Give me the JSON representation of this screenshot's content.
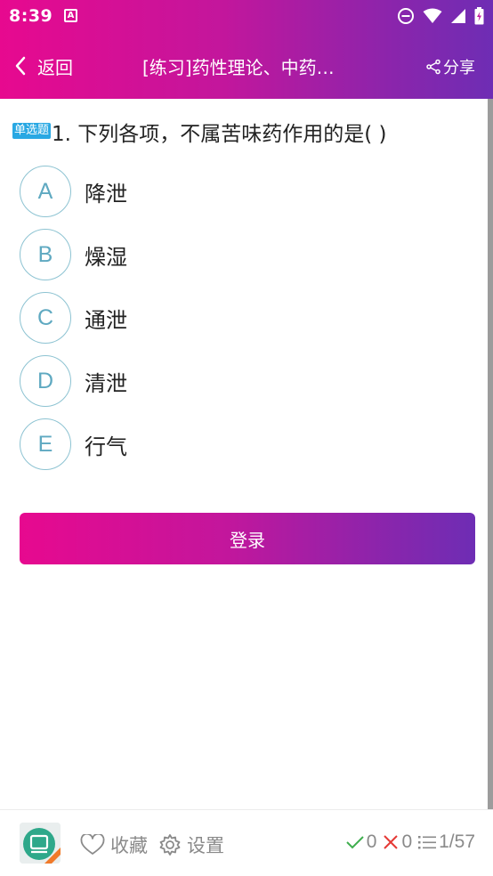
{
  "status": {
    "time": "8:39",
    "notif_icon": "A"
  },
  "nav": {
    "back_label": "返回",
    "title": "[练习]药性理论、中药的作用",
    "share_label": "分享"
  },
  "question": {
    "type_label": "单选题",
    "text": "1. 下列各项，不属苦味药作用的是( )",
    "options": [
      {
        "letter": "A",
        "text": "降泄"
      },
      {
        "letter": "B",
        "text": "燥湿"
      },
      {
        "letter": "C",
        "text": "通泄"
      },
      {
        "letter": "D",
        "text": "清泄"
      },
      {
        "letter": "E",
        "text": "行气"
      }
    ]
  },
  "login_label": "登录",
  "bottom": {
    "favorite_label": "收藏",
    "settings_label": "设置",
    "correct_count": "0",
    "wrong_count": "0",
    "progress": "1/57"
  },
  "colors": {
    "gradient_start": "#e7098f",
    "gradient_end": "#6e2db4",
    "option_border": "#8dc3d2",
    "type_badge": "#29a8e3"
  }
}
